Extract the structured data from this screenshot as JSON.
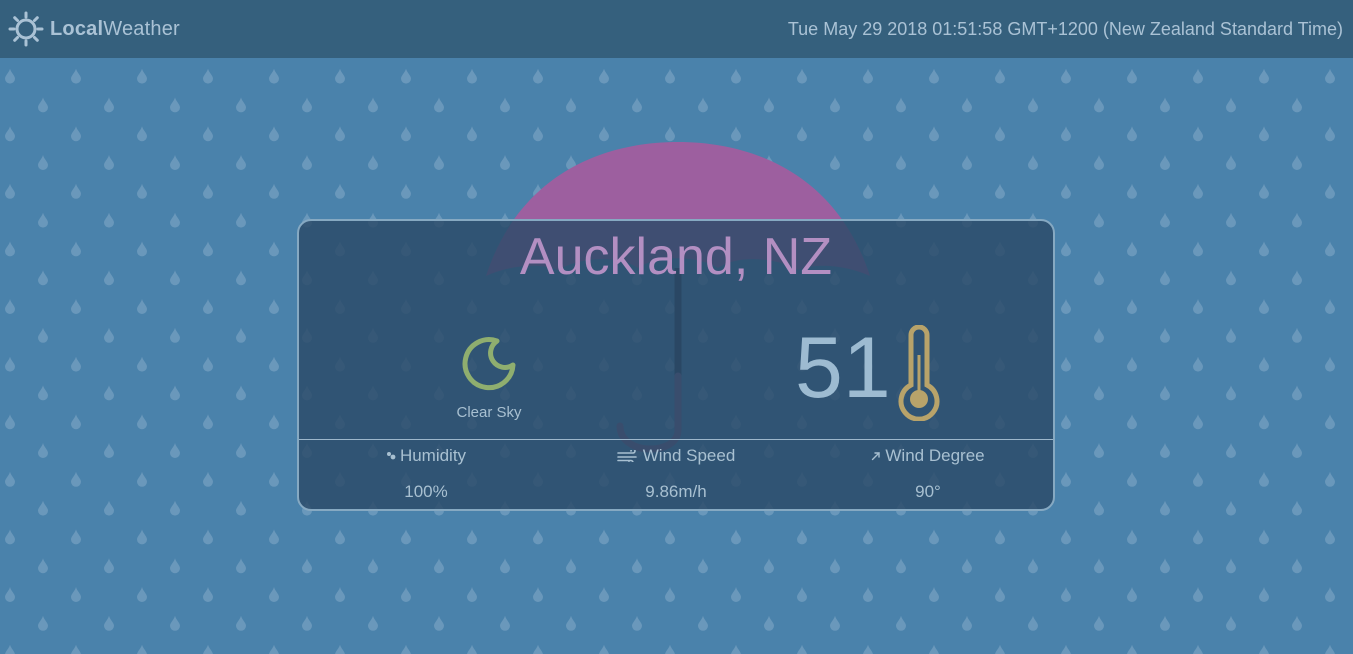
{
  "app": {
    "brand_bold": "Local",
    "brand_rest": "Weather",
    "brand_icon": "sun-icon",
    "datetime": "Tue May 29 2018 01:51:58 GMT+1200 (New Zealand Standard Time)"
  },
  "background": {
    "decoration": "rain-drops",
    "accent_icon": "umbrella-icon",
    "umbrella_color": "#9d5f9f"
  },
  "weather": {
    "location": "Auckland, NZ",
    "condition": "Clear Sky",
    "condition_icon": "moon-icon",
    "temperature": "51",
    "temperature_icon": "thermometer-icon",
    "stats": [
      {
        "label": "Humidity",
        "value": "100%",
        "icon": "humidity-icon"
      },
      {
        "label": "Wind Speed",
        "value": "9.86m/h",
        "icon": "wind-icon"
      },
      {
        "label": "Wind Degree",
        "value": "90°",
        "icon": "arrow-icon"
      }
    ]
  },
  "colors": {
    "background": "#4a82ab",
    "topbar": "#35607d",
    "card": "#2b4b68",
    "city_text": "#b38fc2",
    "icon_green": "#8fae6f",
    "thermo_gold": "#b8a36a"
  }
}
